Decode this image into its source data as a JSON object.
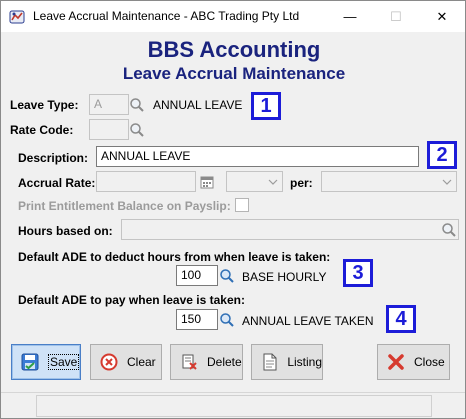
{
  "window": {
    "title": "Leave Accrual Maintenance - ABC Trading Pty Ltd",
    "min_glyph": "—",
    "max_glyph": "☐",
    "close_glyph": "✕"
  },
  "header": {
    "company": "BBS Accounting",
    "subtitle": "Leave Accrual Maintenance"
  },
  "form": {
    "leave_type": {
      "label": "Leave Type:",
      "value": "A",
      "description": "ANNUAL LEAVE"
    },
    "rate_code": {
      "label": "Rate Code:",
      "value": ""
    },
    "description": {
      "label": "Description:",
      "value": "ANNUAL LEAVE"
    },
    "accrual_rate": {
      "label": "Accrual Rate:",
      "value": "",
      "unit": "",
      "per_label": "per:",
      "per_value": ""
    },
    "print_entitlement": {
      "label": "Print Entitlement Balance on Payslip:",
      "checked": false
    },
    "hours_based_on": {
      "label": "Hours based on:",
      "value": ""
    },
    "ade_deduct": {
      "label": "Default ADE to deduct hours from when leave is taken:",
      "value": "100",
      "description": "BASE HOURLY"
    },
    "ade_pay": {
      "label": "Default ADE to pay when leave is taken:",
      "value": "150",
      "description": "ANNUAL LEAVE TAKEN"
    }
  },
  "callouts": [
    "1",
    "2",
    "3",
    "4"
  ],
  "buttons": {
    "save": "Save",
    "clear": "Clear",
    "delete": "Delete",
    "listing": "Listing",
    "close": "Close"
  },
  "icons": {
    "app": "app-icon",
    "lookup": "magnifier-icon",
    "calendar": "calendar-icon",
    "save": "save-disk-icon",
    "clear": "clear-circle-icon",
    "delete": "delete-icon",
    "listing": "document-icon",
    "close": "close-x-icon"
  },
  "colors": {
    "heading": "#1a237e",
    "callout": "#1c1cd8",
    "disabled_text": "#9b9b9b",
    "save_highlight": "#cfe2f7"
  }
}
